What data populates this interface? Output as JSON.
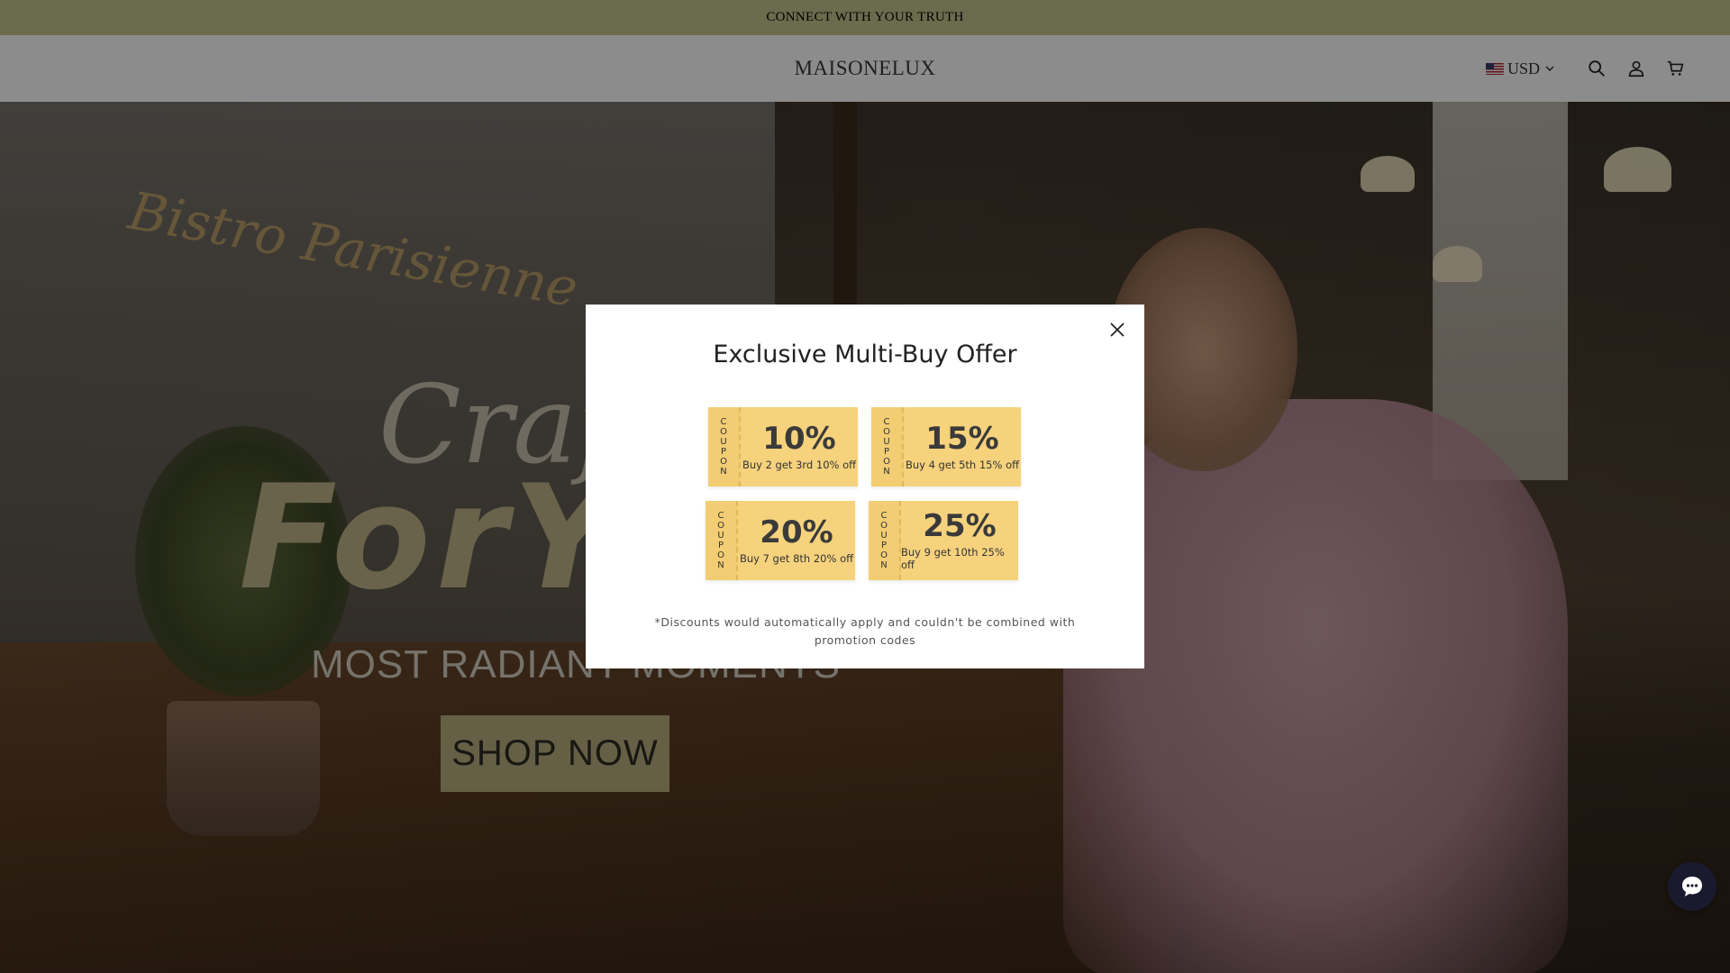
{
  "colors": {
    "announcement_bg": "#c4c38c",
    "header_bg": "#ffffff",
    "coupon_gold": "#f6d27d",
    "chat_bg": "#1a1a2e"
  },
  "announcement": {
    "text": "CONNECT WITH YOUR TRUTH"
  },
  "header": {
    "logo": "MAISONELUX",
    "currency": {
      "flag_icon": "us-flag-icon",
      "label": "USD"
    },
    "icons": [
      "search-icon",
      "account-icon",
      "cart-icon"
    ]
  },
  "hero": {
    "sign_text": "Bistro Parisienne",
    "script_text": "Craf",
    "headline": "ForY",
    "tagline": "MOST RADIANT MOMENTS",
    "cta": "SHOP NOW"
  },
  "modal": {
    "title": "Exclusive Multi-Buy Offer",
    "close_icon": "close-icon",
    "coupon_stub_letters": [
      "C",
      "O",
      "U",
      "P",
      "O",
      "N"
    ],
    "coupons": [
      {
        "percent": "10%",
        "description": "Buy 2 get 3rd 10% off"
      },
      {
        "percent": "15%",
        "description": "Buy 4 get 5th 15% off"
      },
      {
        "percent": "20%",
        "description": "Buy 7 get 8th 20% off"
      },
      {
        "percent": "25%",
        "description": "Buy 9 get 10th 25% off"
      }
    ],
    "note": "*Discounts would automatically apply and couldn't be combined with promotion codes"
  },
  "chat": {
    "icon": "chat-icon"
  }
}
